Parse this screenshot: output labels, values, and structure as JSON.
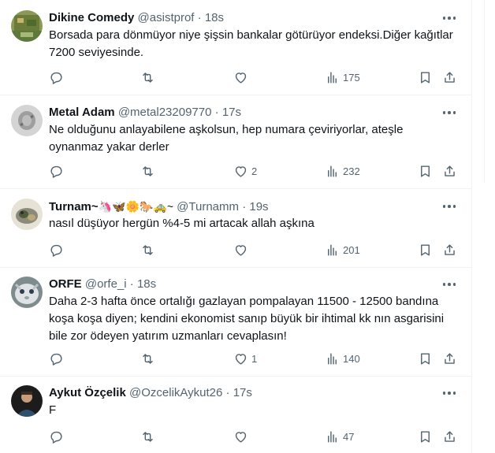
{
  "tweets": [
    {
      "name": "Dikine Comedy",
      "handle": "@asistprof",
      "separator": "·",
      "time": "18s",
      "text": "Borsada para dönmüyor niye şişsin bankalar götürüyor endeksi.Diğer kağıtlar 7200 seviyesinde.",
      "reply_count": "",
      "retweet_count": "",
      "like_count": "",
      "view_count": "175"
    },
    {
      "name": "Metal Adam",
      "handle": "@metal23209770",
      "separator": "·",
      "time": "17s",
      "text": "Ne olduğunu anlayabilene aşkolsun, hep numara çeviriyorlar, ateşle oynanmaz yakar derler",
      "reply_count": "",
      "retweet_count": "",
      "like_count": "2",
      "view_count": "232"
    },
    {
      "name": "Turnam~",
      "name_emoji": "🦄🦋🌼🐎🚕~",
      "handle": "@Turnamm",
      "separator": "·",
      "time": "19s",
      "text": "nasıl düşüyor hergün %4-5 mi artacak allah aşkına",
      "reply_count": "",
      "retweet_count": "",
      "like_count": "",
      "view_count": "201"
    },
    {
      "name": "ORFE",
      "handle": "@orfe_i",
      "separator": "·",
      "time": "18s",
      "text": "Daha 2-3 hafta önce ortalığı gazlayan pompalayan 11500 - 12500 bandına koşa koşa diyen; kendini ekonomist sanıp büyük bir ihtimal kk nın asgarisini bile zor ödeyen yatırım uzmanları cevaplasın!",
      "reply_count": "",
      "retweet_count": "",
      "like_count": "1",
      "view_count": "140"
    },
    {
      "name": "Aykut Özçelik",
      "handle": "@OzcelikAykut26",
      "separator": "·",
      "time": "17s",
      "text": "F",
      "reply_count": "",
      "retweet_count": "",
      "like_count": "",
      "view_count": "47"
    }
  ],
  "icons": {
    "reply": "reply-icon",
    "retweet": "retweet-icon",
    "like": "like-icon",
    "views": "views-icon",
    "bookmark": "bookmark-icon",
    "share": "share-icon",
    "more": "more-icon"
  },
  "colors": {
    "text": "#0f1419",
    "secondary": "#536471",
    "border": "#eff3f4"
  }
}
